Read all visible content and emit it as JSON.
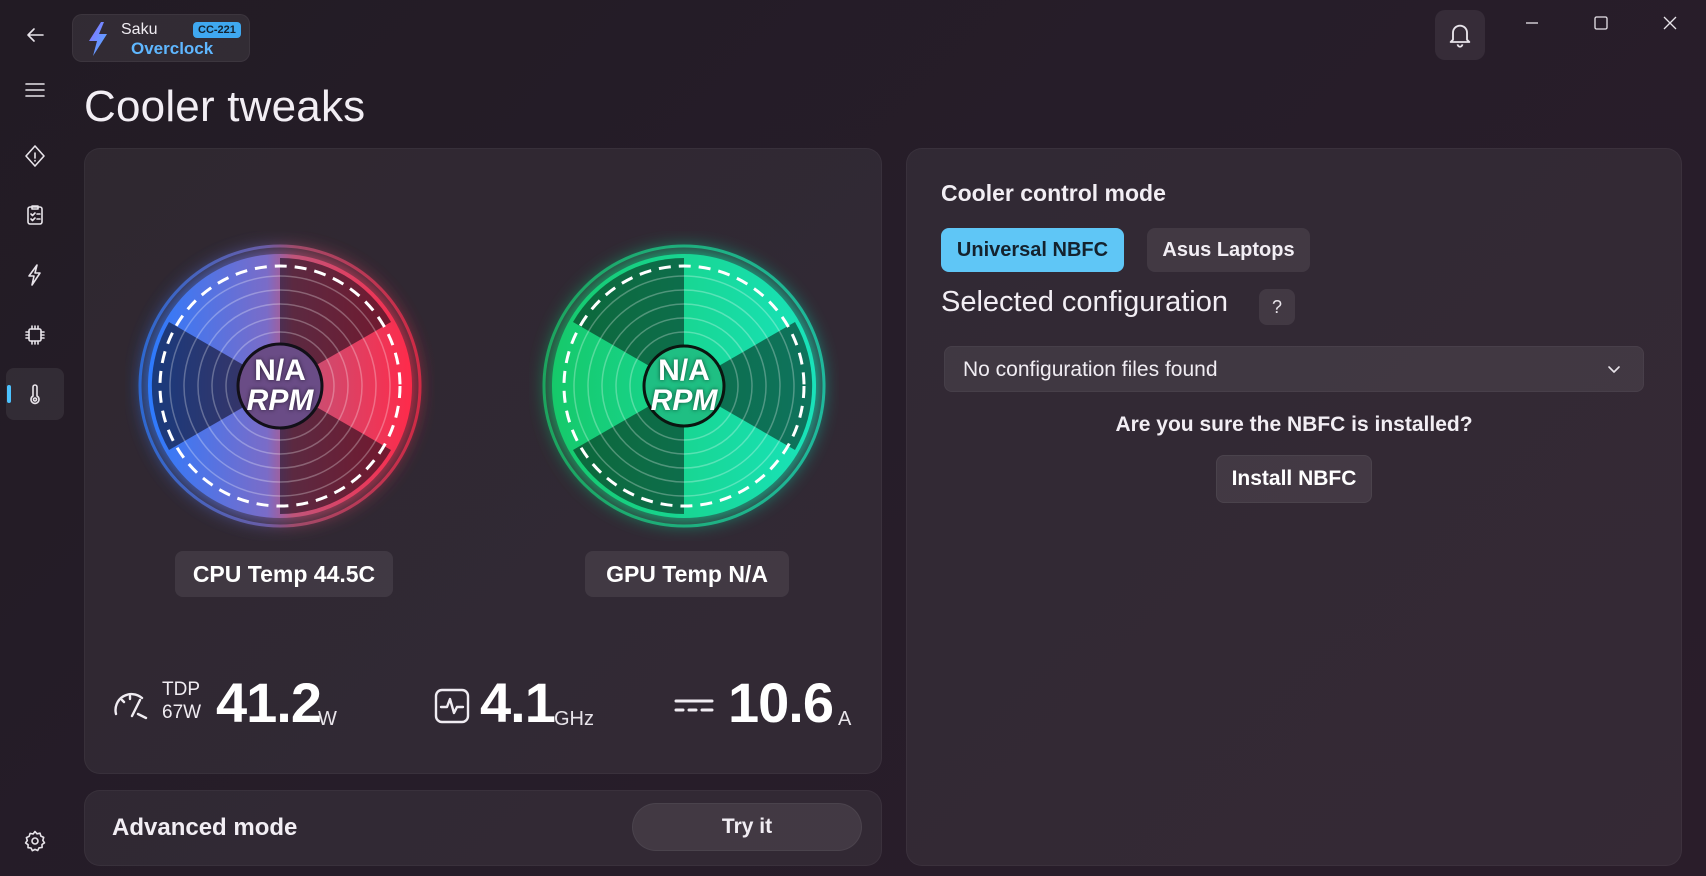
{
  "app": {
    "name_top": "Saku",
    "name_bottom": "Overclock",
    "version_badge": "CC-221"
  },
  "page": {
    "title": "Cooler tweaks"
  },
  "nav": {
    "items": [
      {
        "icon": "back-arrow-icon"
      },
      {
        "icon": "hamburger-menu-icon"
      },
      {
        "icon": "diamond-icon"
      },
      {
        "icon": "clipboard-checklist-icon"
      },
      {
        "icon": "lightning-icon"
      },
      {
        "icon": "cpu-chip-icon"
      },
      {
        "icon": "thermometer-icon",
        "active": true
      },
      {
        "icon": "settings-gear-icon"
      }
    ]
  },
  "fans": {
    "cpu": {
      "line1": "N/A",
      "line2": "RPM",
      "temp_label": "CPU Temp 44.5C",
      "colors": [
        "#2f7fff",
        "#ff2a46"
      ]
    },
    "gpu": {
      "line1": "N/A",
      "line2": "RPM",
      "temp_label": "GPU Temp N/A",
      "colors": [
        "#1fd97a",
        "#19e0b8"
      ]
    }
  },
  "metrics": {
    "tdp": {
      "label": "TDP",
      "limit": "67W",
      "value": "41.2",
      "unit": "W",
      "icon": "gauge-icon"
    },
    "clock": {
      "value": "4.1",
      "unit": "GHz",
      "icon": "pulse-monitor-icon"
    },
    "current": {
      "value": "10.6",
      "unit": "A",
      "icon": "dc-current-icon"
    }
  },
  "advanced": {
    "label": "Advanced mode",
    "button": "Try it"
  },
  "control": {
    "title": "Cooler control mode",
    "modes": [
      "Universal NBFC",
      "Asus Laptops"
    ],
    "selected_mode": "Universal NBFC",
    "selected_config_label": "Selected configuration",
    "help": "?",
    "dropdown_value": "No configuration files found",
    "question": "Are you sure the NBFC is installed?",
    "install_button": "Install NBFC"
  },
  "accent": "#4cc2ff"
}
